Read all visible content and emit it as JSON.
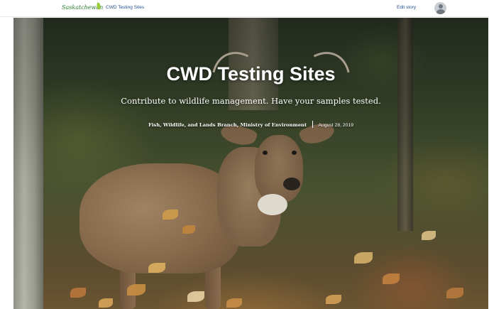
{
  "header": {
    "brand": "Saskatchewan",
    "story_title": "CWD Testing Sites",
    "edit_label": "Edit story",
    "avatar_icon": "user-icon"
  },
  "hero": {
    "title": "CWD Testing Sites",
    "subtitle": "Contribute to wildlife management. Have your samples tested.",
    "author": "Fish, Wildlife, and Lands Branch, Ministry of Environment",
    "date": "August 28, 2019",
    "image_subject": "white-tailed deer in forest"
  },
  "colors": {
    "brand_green": "#2e7d32",
    "link_blue": "#1f4e8c",
    "hero_text": "#ffffff"
  }
}
